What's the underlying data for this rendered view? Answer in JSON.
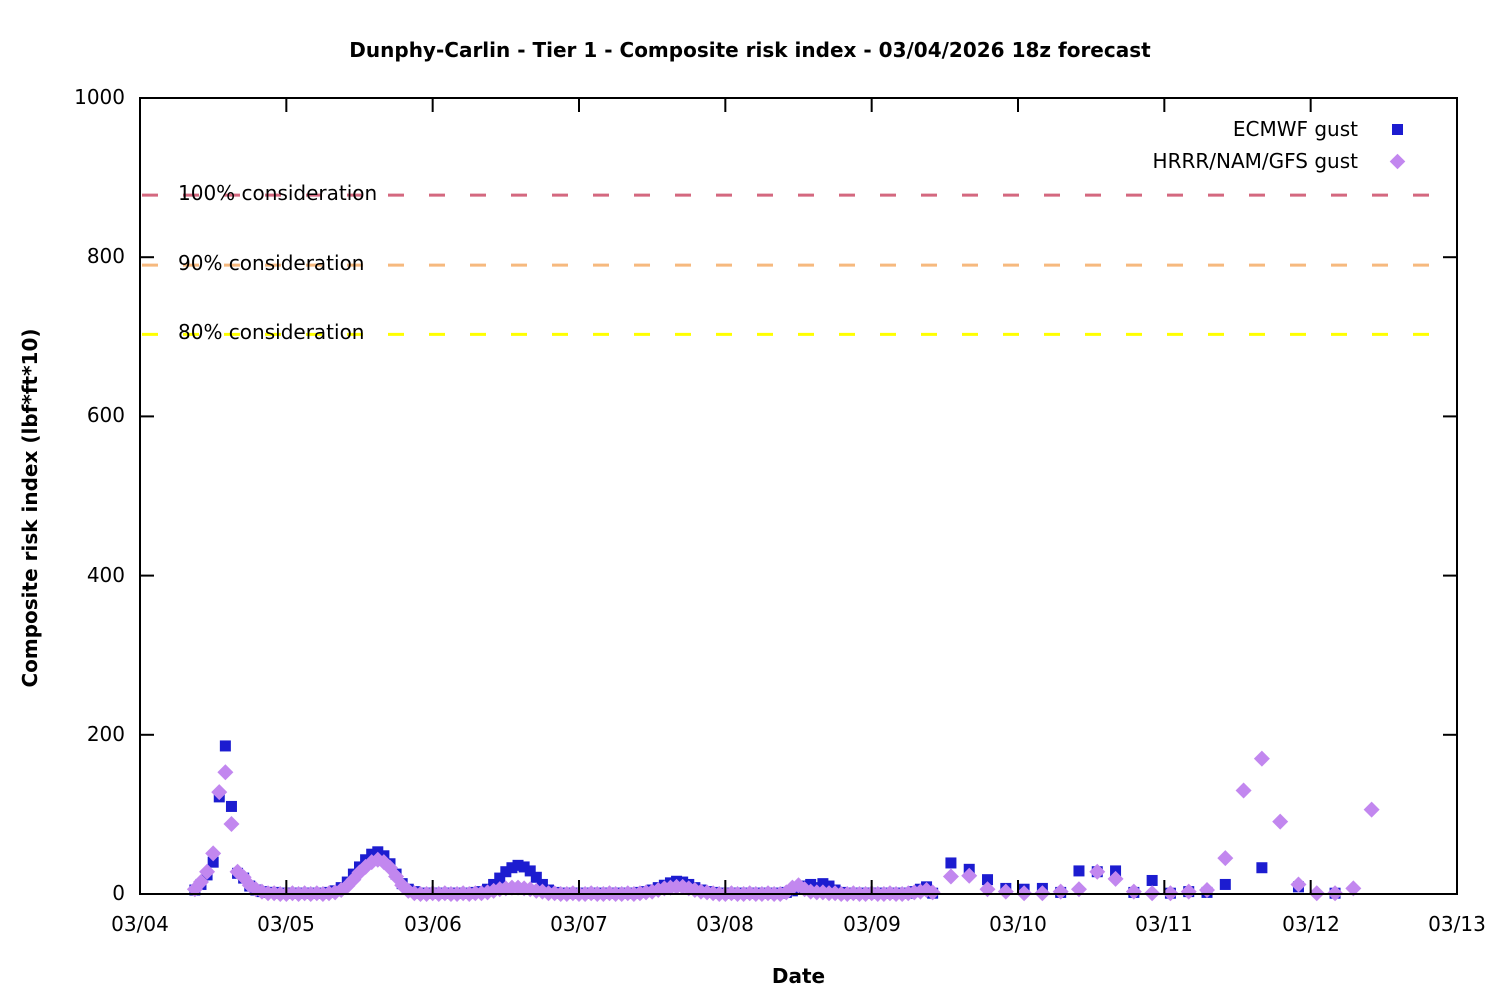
{
  "chart_data": {
    "type": "scatter",
    "title": "Dunphy-Carlin - Tier 1 - Composite risk index - 03/04/2026 18z forecast",
    "xlabel": "Date",
    "ylabel": "Composite risk index (lbf*ft*10)",
    "x_tick_labels": [
      "03/04",
      "03/05",
      "03/06",
      "03/07",
      "03/08",
      "03/09",
      "03/10",
      "03/11",
      "03/12",
      "03/13"
    ],
    "y_tick_labels": [
      "0",
      "200",
      "400",
      "600",
      "800",
      "1000"
    ],
    "ylim": [
      0,
      1000
    ],
    "x_span_days": 9,
    "grid": false,
    "legend_position": "top-right-inside",
    "thresholds": [
      {
        "label": "100% consideration",
        "value": 878,
        "color": "#d4687f",
        "style": "dashed"
      },
      {
        "label": "90% consideration",
        "value": 790,
        "color": "#f6b97e",
        "style": "dashed"
      },
      {
        "label": "80% consideration",
        "value": 703,
        "color": "#ffff00",
        "style": "dashed"
      }
    ],
    "x_encoding": "hours after 03/04 00:00",
    "series": [
      {
        "name": "ECMWF gust",
        "marker": "square",
        "color": "#1c1cd0",
        "dense": {
          "start_hour": 9,
          "step_hours": 1,
          "values": [
            5,
            12,
            24,
            40,
            122,
            186,
            110,
            26,
            20,
            10,
            5,
            3,
            2,
            2,
            1,
            1,
            1,
            1,
            1,
            1,
            1,
            1,
            2,
            4,
            8,
            15,
            25,
            34,
            43,
            50,
            53,
            48,
            38,
            25,
            13,
            6,
            3,
            1,
            1,
            1,
            1,
            1,
            1,
            1,
            1,
            1,
            2,
            3,
            6,
            12,
            20,
            28,
            33,
            36,
            34,
            29,
            21,
            12,
            5,
            2,
            1,
            1,
            1,
            1,
            1,
            1,
            1,
            1,
            1,
            1,
            1,
            1,
            1,
            2,
            3,
            5,
            8,
            11,
            14,
            16,
            15,
            12,
            8,
            5,
            3,
            2,
            1,
            1,
            1,
            1,
            1,
            1,
            1,
            1,
            1,
            1,
            1,
            2,
            4,
            6,
            10,
            12,
            8,
            13,
            10,
            5,
            2,
            1,
            1,
            1,
            1,
            1,
            1,
            1,
            1,
            1,
            1,
            1,
            3,
            6,
            9,
            1
          ]
        },
        "sparse_points": [
          [
            133,
            39
          ],
          [
            136,
            31
          ],
          [
            139,
            18
          ],
          [
            142,
            7
          ],
          [
            145,
            6
          ],
          [
            148,
            7
          ],
          [
            151,
            2
          ],
          [
            154,
            29
          ],
          [
            157,
            28
          ],
          [
            160,
            29
          ],
          [
            163,
            2
          ],
          [
            166,
            17
          ],
          [
            169,
            1
          ],
          [
            172,
            3
          ],
          [
            175,
            2
          ],
          [
            178,
            12
          ],
          [
            184,
            33
          ],
          [
            190,
            9
          ],
          [
            196,
            1
          ]
        ]
      },
      {
        "name": "HRRR/NAM/GFS gust",
        "marker": "diamond",
        "color": "#c287ef",
        "dense": {
          "start_hour": 9,
          "step_hours": 1,
          "values": [
            6,
            15,
            28,
            51,
            128,
            153,
            88,
            28,
            21,
            11,
            6,
            3,
            1,
            1,
            0,
            0,
            1,
            0,
            1,
            0,
            1,
            0,
            1,
            2,
            5,
            10,
            18,
            27,
            34,
            40,
            43,
            40,
            33,
            22,
            11,
            4,
            1,
            0,
            0,
            1,
            0,
            1,
            0,
            0,
            1,
            0,
            1,
            1,
            2,
            4,
            6,
            7,
            8,
            8,
            7,
            6,
            4,
            3,
            1,
            1,
            0,
            0,
            1,
            0,
            0,
            1,
            0,
            0,
            1,
            0,
            0,
            1,
            0,
            1,
            2,
            3,
            5,
            7,
            8,
            9,
            9,
            7,
            5,
            3,
            2,
            1,
            0,
            0,
            1,
            0,
            0,
            1,
            0,
            0,
            1,
            0,
            0,
            2,
            8,
            11,
            6,
            3,
            2,
            2,
            1,
            1,
            0,
            0,
            1,
            0,
            0,
            1,
            0,
            0,
            1,
            0,
            0,
            1,
            2,
            3,
            5,
            2
          ]
        },
        "sparse_points": [
          [
            133,
            22
          ],
          [
            136,
            23
          ],
          [
            139,
            6
          ],
          [
            142,
            3
          ],
          [
            145,
            1
          ],
          [
            148,
            1
          ],
          [
            151,
            3
          ],
          [
            154,
            6
          ],
          [
            157,
            28
          ],
          [
            160,
            19
          ],
          [
            163,
            3
          ],
          [
            166,
            1
          ],
          [
            169,
            1
          ],
          [
            172,
            3
          ],
          [
            175,
            5
          ],
          [
            178,
            45
          ],
          [
            181,
            130
          ],
          [
            184,
            170
          ],
          [
            187,
            91
          ],
          [
            190,
            12
          ],
          [
            193,
            1
          ],
          [
            196,
            1
          ],
          [
            199,
            7
          ],
          [
            202,
            106
          ]
        ]
      }
    ]
  }
}
